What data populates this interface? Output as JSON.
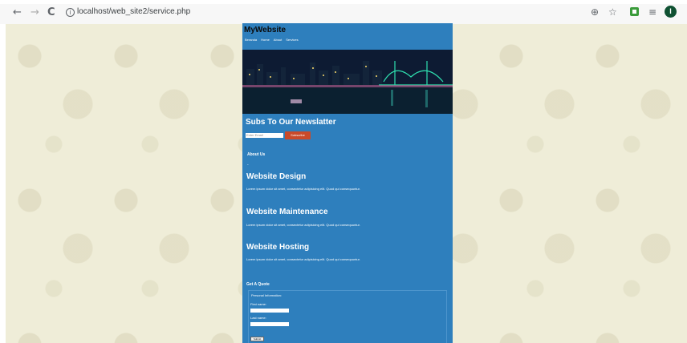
{
  "browser": {
    "back_icon": "←",
    "forward_icon": "→",
    "reload_icon": "C",
    "info_icon": "i",
    "url": "localhost/web_site2/service.php",
    "zoom_icon": "⊕",
    "star_icon": "☆",
    "media_icon": "≡",
    "profile_initial": "I"
  },
  "site": {
    "brand": "MyWebsite",
    "menu": [
      "Beranda",
      "Home",
      "About",
      "Services"
    ],
    "newsletter": {
      "title": "Subs To Our Newslatter",
      "email_placeholder": "Enter Email",
      "subscribe_label": "Subscribe"
    },
    "about_label": "About Us",
    "dot": "-",
    "services": [
      {
        "title": "Website Design",
        "text": "Lorem ipsum dolor sit amet, consectetur adipisicing elit. Quod qui consequuntur."
      },
      {
        "title": "Website Maintenance",
        "text": "Lorem ipsum dolor sit amet, consectetur adipisicing elit. Quod qui consequuntur."
      },
      {
        "title": "Website Hosting",
        "text": "Lorem ipsum dolor sit amet, consectetur adipisicing elit. Quod qui consequuntur."
      }
    ],
    "quote": {
      "title": "Get A Quote",
      "legend": "Personal Information:",
      "first_name_label": "First name:",
      "last_name_label": "Last name:",
      "submit_label": "Submit"
    }
  },
  "colors": {
    "site_blue": "#2e7fbd",
    "subscribe_red": "#c94a2a",
    "page_background": "#efedd8"
  }
}
